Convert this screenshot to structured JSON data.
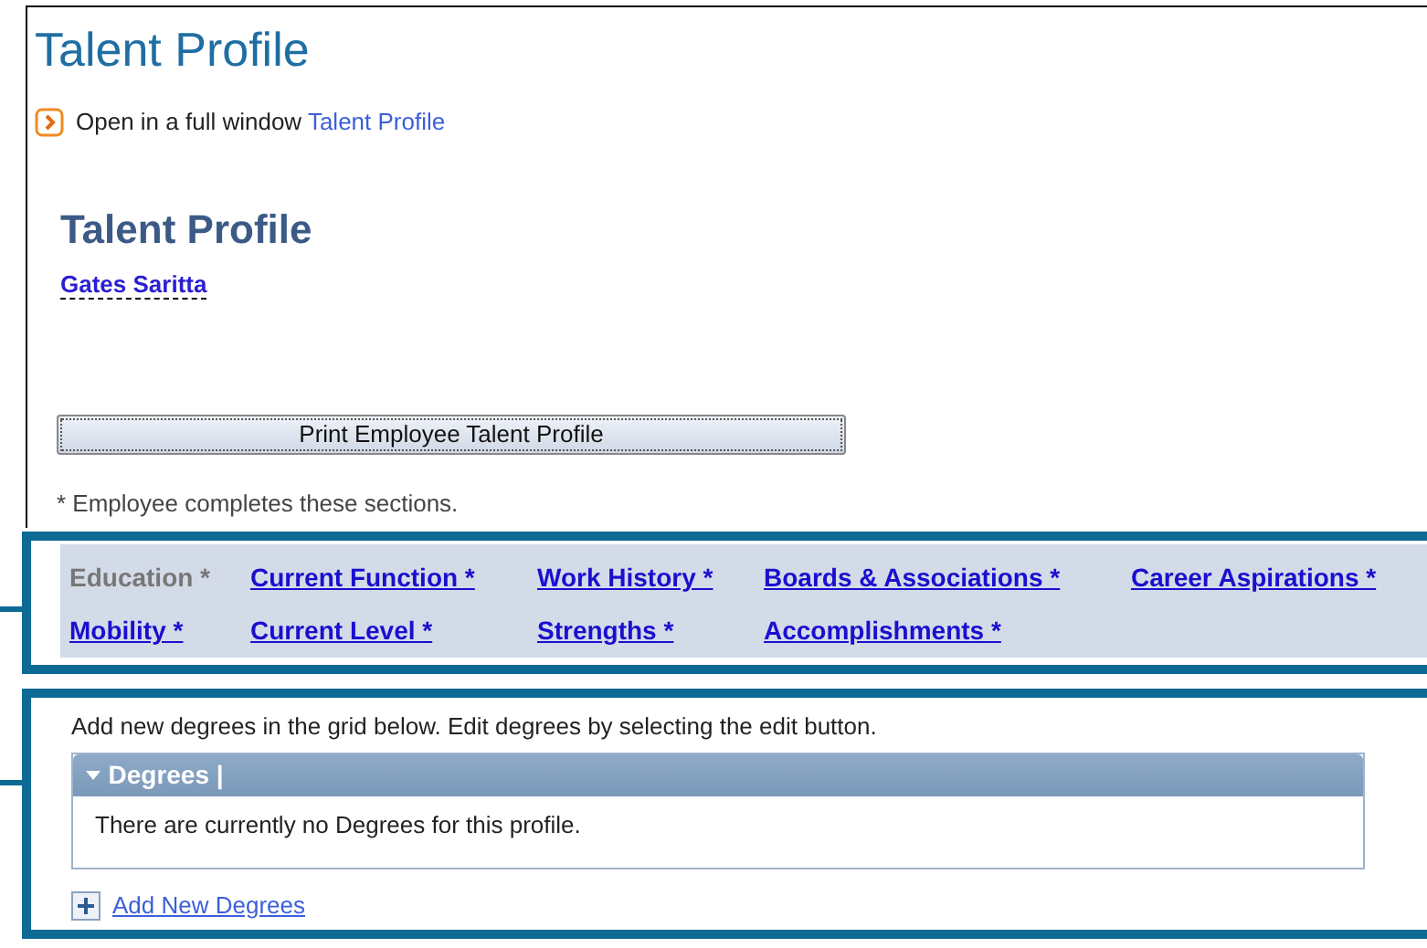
{
  "page_title": "Talent Profile",
  "open_link": {
    "text": "Open in a full window",
    "link": "Talent Profile"
  },
  "profile": {
    "title": "Talent Profile",
    "employee": "Gates Saritta"
  },
  "print_button": "Print Employee Talent Profile",
  "note": "* Employee completes these sections.",
  "sections": [
    {
      "label": "Education *",
      "selected": true
    },
    {
      "label": "Current Function *",
      "selected": false
    },
    {
      "label": "Work History *",
      "selected": false
    },
    {
      "label": "Boards & Associations *",
      "selected": false
    },
    {
      "label": "Career Aspirations *",
      "selected": false
    },
    {
      "label": "Mobility *",
      "selected": false
    },
    {
      "label": "Current Level *",
      "selected": false
    },
    {
      "label": "Strengths *",
      "selected": false
    },
    {
      "label": "Accomplishments *",
      "selected": false
    }
  ],
  "degrees": {
    "instructions": "Add new degrees in the grid below.  Edit degrees by selecting the edit button.",
    "grid_title": "Degrees |",
    "expanded": true,
    "empty_message": "There are currently no Degrees for this profile.",
    "add_link": "Add New Degrees"
  }
}
